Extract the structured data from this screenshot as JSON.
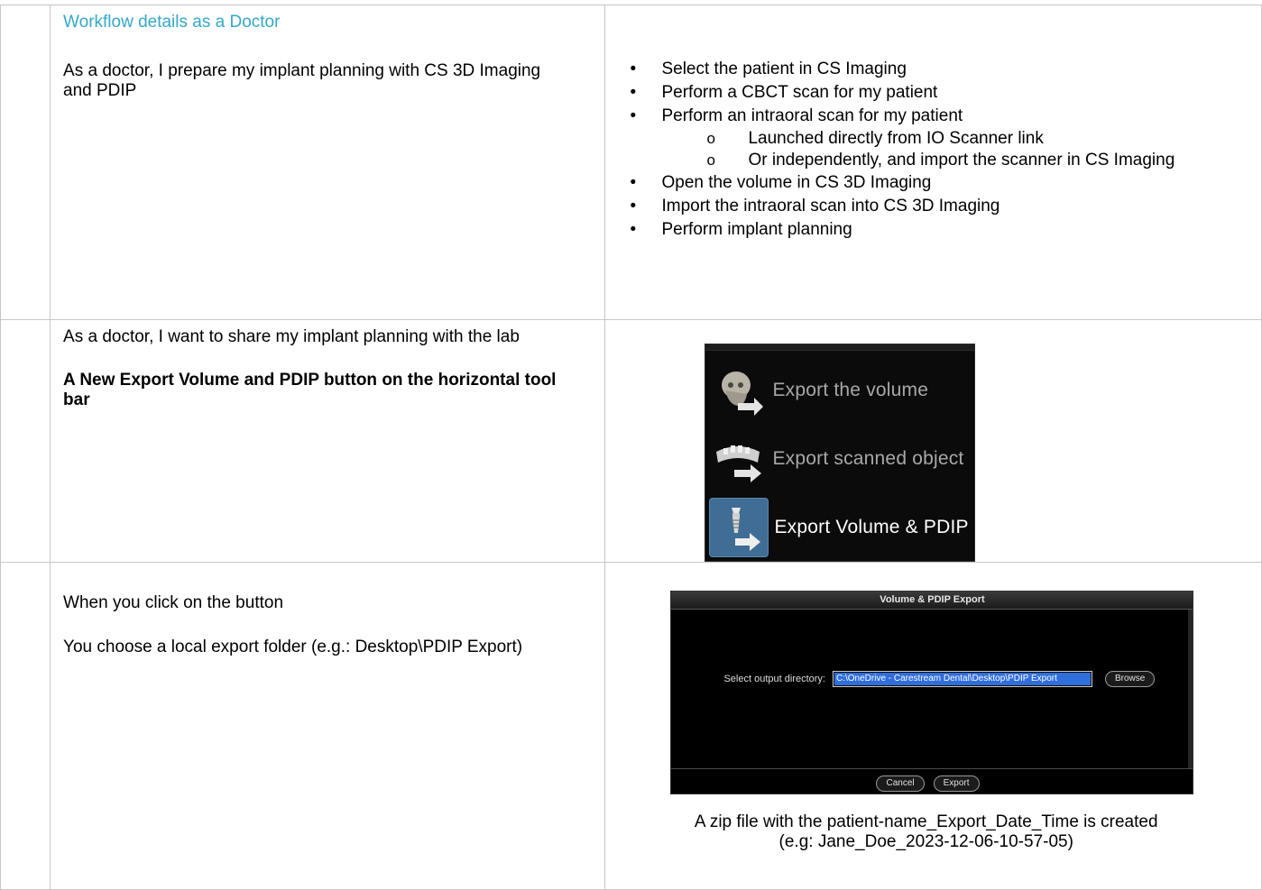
{
  "rows": [
    {
      "heading": "Workflow details as a Doctor",
      "description": "As a doctor, I prepare my implant planning with CS 3D Imaging and PDIP",
      "steps": [
        {
          "text": "Select the patient in CS Imaging",
          "sub": []
        },
        {
          "text": "Perform a CBCT scan for my patient",
          "sub": []
        },
        {
          "text": "Perform an intraoral scan for my patient",
          "sub": [
            "Launched directly from IO Scanner link",
            "Or independently, and import the scanner in CS Imaging"
          ]
        },
        {
          "text": "Open the volume in CS 3D Imaging",
          "sub": []
        },
        {
          "text": "Import the intraoral scan into CS 3D Imaging",
          "sub": []
        },
        {
          "text": "Perform implant planning",
          "sub": []
        }
      ]
    },
    {
      "description": "As a doctor, I want to share my implant planning with the lab",
      "note": "A New Export Volume and PDIP button on the horizontal tool bar",
      "toolbar": {
        "items": [
          {
            "label": "Export the volume",
            "icon": "skull-export-icon",
            "active": false
          },
          {
            "label": "Export scanned object",
            "icon": "jaw-scan-export-icon",
            "active": false
          },
          {
            "label": "Export Volume & PDIP",
            "icon": "implant-export-icon",
            "active": true
          }
        ]
      }
    },
    {
      "line1": "When you click on the button",
      "line2": "You choose a local export folder (e.g.: Desktop\\PDIP Export)",
      "dialog": {
        "title": "Volume & PDIP Export",
        "label": "Select output directory:",
        "path": "C:\\OneDrive - Carestream Dental\\Desktop\\PDIP Export",
        "browse": "Browse",
        "cancel": "Cancel",
        "export": "Export"
      },
      "caption1": "A zip file with the patient-name_Export_Date_Time is created",
      "caption2": "(e.g: Jane_Doe_2023-12-06-10-57-05)"
    }
  ],
  "colors": {
    "heading": "#34a9c7",
    "active_button": "#3f6d96",
    "selection": "#2f6edb"
  }
}
